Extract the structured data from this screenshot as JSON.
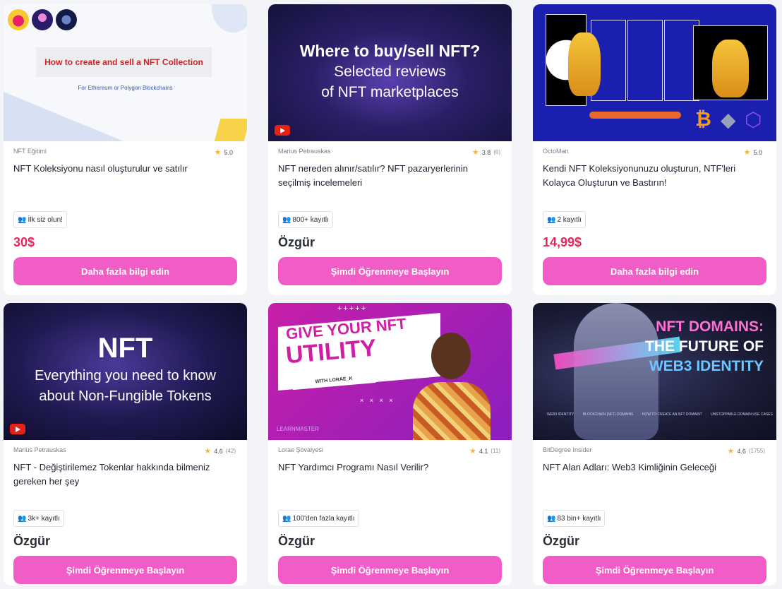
{
  "cards": [
    {
      "thumbnail": {
        "heading": "How to create and sell a NFT Collection",
        "subheading": "For Ethereum or Polygon Blockchains"
      },
      "author": "NFT Eğitimi",
      "rating": "5.0",
      "rating_count": "",
      "title": "NFT Koleksiyonu nasıl oluşturulur ve satılır",
      "enrollment": "İlk siz olun!",
      "price": "30$",
      "price_type": "paid",
      "button_label": "Daha fazla bilgi edin"
    },
    {
      "thumbnail": {
        "line1": "Where to buy/sell NFT?",
        "line2": "Selected reviews",
        "line3": "of NFT marketplaces"
      },
      "author": "Marius Petrauskas",
      "rating": "3.8",
      "rating_count": "(6)",
      "title": "NFT nereden alınır/satılır? NFT pazaryerlerinin seçilmiş incelemeleri",
      "enrollment": "800+ kayıtlı",
      "price": "Özgür",
      "price_type": "free",
      "button_label": "Şimdi Öğrenmeye Başlayın"
    },
    {
      "thumbnail": {},
      "author": "OctoMan",
      "rating": "5.0",
      "rating_count": "",
      "title": "Kendi NFT Koleksiyonunuzu oluşturun, NTF'leri Kolayca Oluşturun ve Bastırın!",
      "enrollment": "2 kayıtlı",
      "price": "14,99$",
      "price_type": "paid",
      "button_label": "Daha fazla bilgi edin"
    },
    {
      "thumbnail": {
        "line1": "NFT",
        "line2": "Everything you need to know",
        "line3": "about Non-Fungible Tokens"
      },
      "author": "Marius Petrauskas",
      "rating": "4.6",
      "rating_count": "(42)",
      "title": "NFT - Değiştirilemez Tokenlar hakkında bilmeniz gereken her şey",
      "enrollment": "3k+ kayıtlı",
      "price": "Özgür",
      "price_type": "free",
      "button_label": "Şimdi Öğrenmeye Başlayın"
    },
    {
      "thumbnail": {
        "line1": "GIVE YOUR NFT",
        "line2": "UTILITY",
        "tag": "WITH LORAE_K",
        "plus": "+++++",
        "xs": "× × × ×",
        "logo": "LEARNMASTER"
      },
      "author": "Lorae Şövalyesi",
      "rating": "4.1",
      "rating_count": "(11)",
      "title": "NFT Yardımcı Programı Nasıl Verilir?",
      "enrollment": "100'den fazla kayıtlı",
      "price": "Özgür",
      "price_type": "free",
      "button_label": "Şimdi Öğrenmeye Başlayın"
    },
    {
      "thumbnail": {
        "line1": "NFT DOMAINS:",
        "line2": "THE FUTURE OF",
        "line3": "WEB3 IDENTITY",
        "flow": [
          "WEB3 IDENTITY",
          "BLOCKCHAIN (NFT) DOMAINS",
          "HOW TO CREATE AN NFT DOMAIN?",
          "UNSTOPPABLE DOMAIN USE CASES"
        ]
      },
      "author": "BitDegree Insider",
      "rating": "4.6",
      "rating_count": "(1755)",
      "title": "NFT Alan Adları: Web3 Kimliğinin Geleceği",
      "enrollment": "83 bin+ kayıtlı",
      "price": "Özgür",
      "price_type": "free",
      "button_label": "Şimdi Öğrenmeye Başlayın"
    }
  ],
  "colors": {
    "button": "#f15cc6",
    "paid_price": "#e8255b",
    "star": "#f4b63a"
  },
  "icons": {
    "rating": "star-icon",
    "enrollment": "users-icon",
    "video": "youtube-icon"
  }
}
